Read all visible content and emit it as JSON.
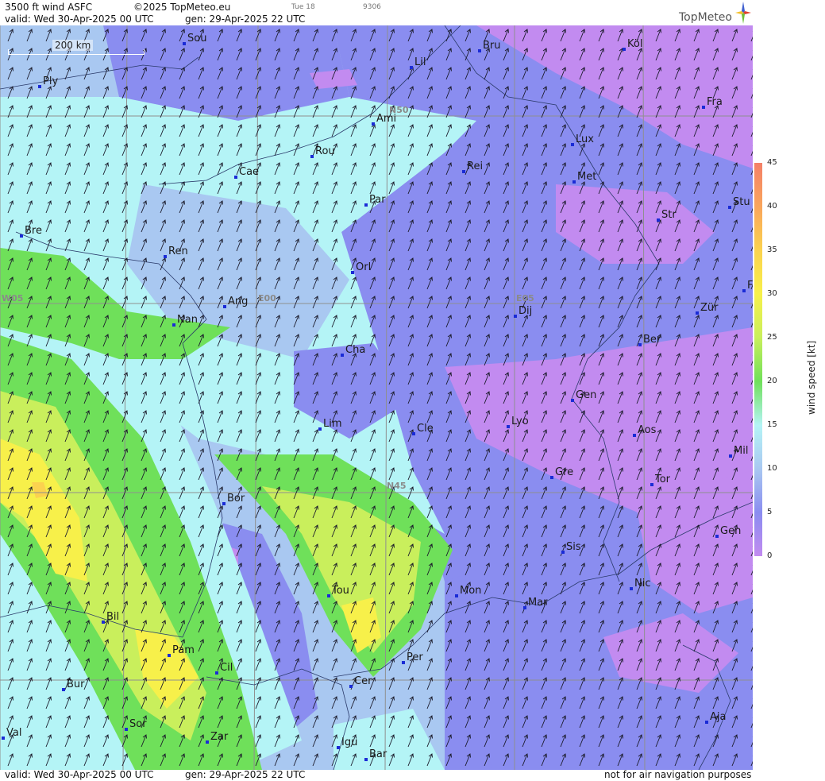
{
  "header": {
    "product": "3500 ft wind ASFC",
    "copyright": "©2025 TopMeteo.eu",
    "step": "Tue 18",
    "code": "9306",
    "valid": "valid:  Wed  30-Apr-2025  00 UTC",
    "gen": "gen: 29-Apr-2025 22 UTC"
  },
  "logo": "TopMeteo",
  "scalebar": {
    "label": "200 km"
  },
  "grid_labels": [
    "N50",
    "N45",
    "W05",
    "E00",
    "E05"
  ],
  "cities": [
    "Sou",
    "Bru",
    "Köl",
    "Lil",
    "Ply",
    "Ami",
    "Fra",
    "Lux",
    "Rou",
    "Cae",
    "Rei",
    "Met",
    "Par",
    "Stu",
    "Str",
    "Bre",
    "Ren",
    "Orl",
    "Ang",
    "Dij",
    "Zür",
    "Nan",
    "Ber",
    "Cha",
    "Gen",
    "Lim",
    "Cle",
    "Lyo",
    "Aos",
    "Mil",
    "Gre",
    "Tor",
    "Bor",
    "Sis",
    "Gen",
    "Tou",
    "Mon",
    "Nic",
    "Mar",
    "Bil",
    "Pam",
    "Cil",
    "Per",
    "Bur",
    "Cer",
    "Sor",
    "Aja",
    "Val",
    "Zar",
    "Igu",
    "Bar",
    "F"
  ],
  "legend": {
    "unit": "wind speed [kt]",
    "ticks": [
      "45",
      "40",
      "35",
      "30",
      "25",
      "20",
      "15",
      "10",
      "5",
      "0"
    ],
    "colors": [
      "#f48068",
      "#f9a55c",
      "#fbd24f",
      "#f7f04a",
      "#c9ef5c",
      "#6fe05a",
      "#b4f4f6",
      "#a9c8f1",
      "#8a8df0",
      "#c28bf0"
    ]
  },
  "footer": {
    "valid": "valid:  Wed  30-Apr-2025  00 UTC",
    "gen": "gen: 29-Apr-2025 22 UTC",
    "note": "not for air navigation purposes"
  }
}
